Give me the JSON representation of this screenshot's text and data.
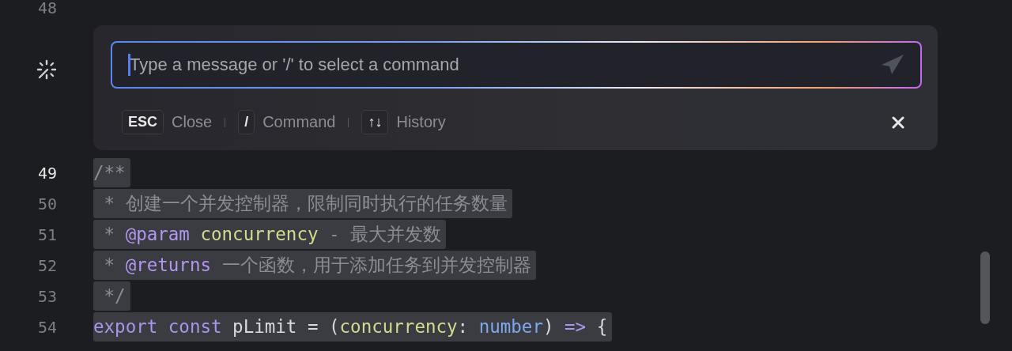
{
  "gutter_top": {
    "line_number": "48"
  },
  "prompt": {
    "placeholder": "Type a message or '/' to select a command",
    "hints": [
      {
        "key": "ESC",
        "label": "Close"
      },
      {
        "key": "/",
        "label": "Command"
      },
      {
        "key": "↑↓",
        "label": "History"
      }
    ]
  },
  "code_lines": [
    {
      "number": "49",
      "current": true,
      "selected": true,
      "tokens": [
        {
          "kind": "comment",
          "text": "/**"
        }
      ]
    },
    {
      "number": "50",
      "current": false,
      "selected": true,
      "tokens": [
        {
          "kind": "comment",
          "text": " * 创建一个并发控制器，限制同时执行的任务数量"
        }
      ]
    },
    {
      "number": "51",
      "current": false,
      "selected": true,
      "tokens": [
        {
          "kind": "comment",
          "text": " * "
        },
        {
          "kind": "tag",
          "text": "@param"
        },
        {
          "kind": "param",
          "text": " concurrency"
        },
        {
          "kind": "comment",
          "text": " - 最大并发数"
        }
      ]
    },
    {
      "number": "52",
      "current": false,
      "selected": true,
      "tokens": [
        {
          "kind": "comment",
          "text": " * "
        },
        {
          "kind": "tag",
          "text": "@returns"
        },
        {
          "kind": "comment",
          "text": " 一个函数，用于添加任务到并发控制器"
        }
      ]
    },
    {
      "number": "53",
      "current": false,
      "selected": true,
      "tokens": [
        {
          "kind": "comment",
          "text": " */"
        }
      ]
    },
    {
      "number": "54",
      "current": false,
      "selected": true,
      "tokens": [
        {
          "kind": "keyword",
          "text": "export"
        },
        {
          "kind": "keyword",
          "text": " const"
        },
        {
          "kind": "ident",
          "text": " pLimit"
        },
        {
          "kind": "plain",
          "text": " = ("
        },
        {
          "kind": "param",
          "text": "concurrency"
        },
        {
          "kind": "plain",
          "text": ": "
        },
        {
          "kind": "type",
          "text": "number"
        },
        {
          "kind": "plain",
          "text": ") "
        },
        {
          "kind": "keyword",
          "text": "=>"
        },
        {
          "kind": "plain",
          "text": " {"
        }
      ]
    }
  ]
}
